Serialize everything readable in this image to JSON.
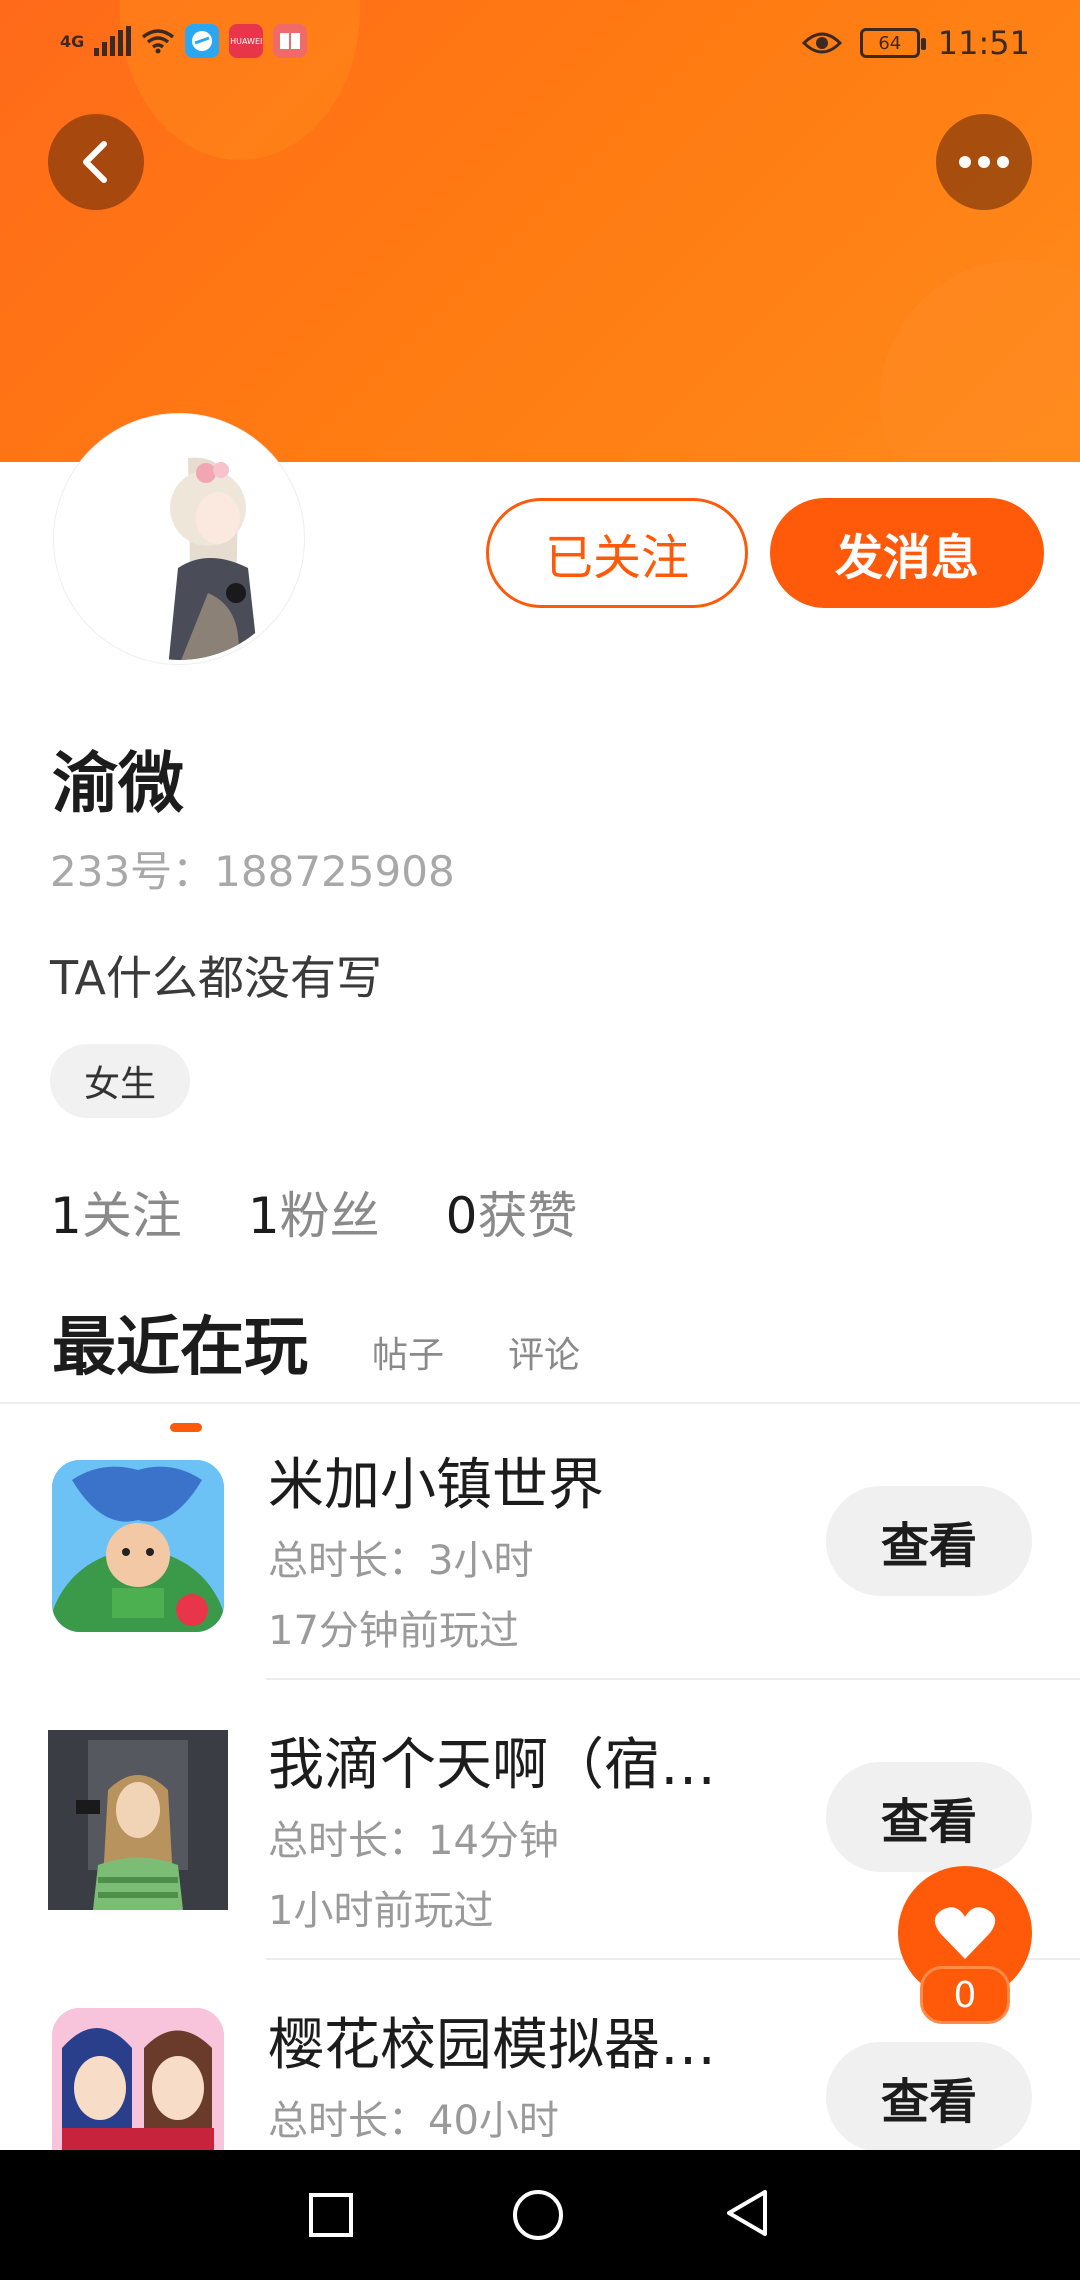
{
  "status_bar": {
    "network": "4G",
    "battery": "64",
    "time": "11:51",
    "app_icons": [
      "browser-icon",
      "huawei-store-icon",
      "book-icon"
    ],
    "huawei_label": "HUAWEI"
  },
  "header": {
    "back_icon": "back-arrow-icon",
    "more_icon": "more-dots-icon"
  },
  "profile": {
    "follow_label": "已关注",
    "message_label": "发消息",
    "name": "渝微",
    "uid": "233号：188725908",
    "bio": "TA什么都没有写",
    "tag": "女生",
    "stats": [
      {
        "num": "1",
        "label": "关注"
      },
      {
        "num": "1",
        "label": "粉丝"
      },
      {
        "num": "0",
        "label": "获赞"
      }
    ]
  },
  "tabs": {
    "active": "最近在玩",
    "others": [
      "帖子",
      "评论"
    ]
  },
  "games": [
    {
      "title": "米加小镇世界",
      "duration": "总时长：3小时",
      "played": "17分钟前玩过",
      "button": "查看"
    },
    {
      "title": "我滴个天啊（宿…",
      "duration": "总时长：14分钟",
      "played": "1小时前玩过",
      "button": "查看"
    },
    {
      "title": "樱花校园模拟器…",
      "duration": "总时长：40小时",
      "played": "",
      "button": "查看"
    }
  ],
  "like_fab": {
    "count": "0"
  },
  "colors": {
    "accent": "#ff5a0a",
    "banner": "#ff7a12"
  }
}
